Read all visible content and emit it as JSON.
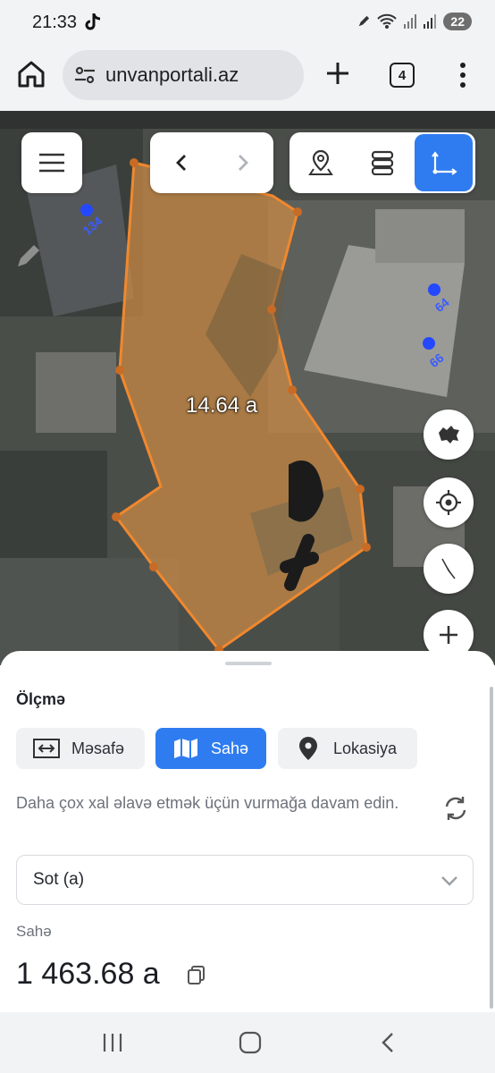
{
  "status_bar": {
    "time": "21:33",
    "battery": "22",
    "app_icon": "tiktok-icon",
    "status_icons": [
      "pen-icon",
      "wifi-icon",
      "signal-icon",
      "signal-icon"
    ]
  },
  "browser": {
    "url": "unvanportali.az",
    "tab_count": "4",
    "icons": [
      "home-icon",
      "site-settings-icon",
      "plus-icon",
      "more-icon"
    ]
  },
  "map": {
    "area_label": "14.64 a",
    "parcel_numbers": [
      "134",
      "64",
      "66"
    ],
    "colors": {
      "parcel_stroke": "#f0882e",
      "parcel_fill": "#d98a3a",
      "accent": "#2f7cf0",
      "parcel_point": "#2448ff"
    },
    "controls": [
      "menu-icon",
      "back-icon",
      "forward-icon",
      "location-pin-icon",
      "layers-icon",
      "measure-icon",
      "azerbaijan-map-icon",
      "locate-icon",
      "compass-icon",
      "zoom-in-icon",
      "pencil-icon"
    ]
  },
  "sheet": {
    "title": "Ölçmə",
    "modes": [
      {
        "label": "Məsafə",
        "icon": "distance-icon",
        "active": false
      },
      {
        "label": "Sahə",
        "icon": "map-icon",
        "active": true
      },
      {
        "label": "Lokasiya",
        "icon": "pin-icon",
        "active": false
      }
    ],
    "hint": "Daha çox xal əlavə etmək üçün vurmağa davam edin.",
    "unit_select": "Sot (a)",
    "result_label": "Sahə",
    "result_value": "1 463.68 a"
  },
  "navbar": {
    "icons": [
      "recents-icon",
      "home-icon",
      "back-icon"
    ]
  }
}
